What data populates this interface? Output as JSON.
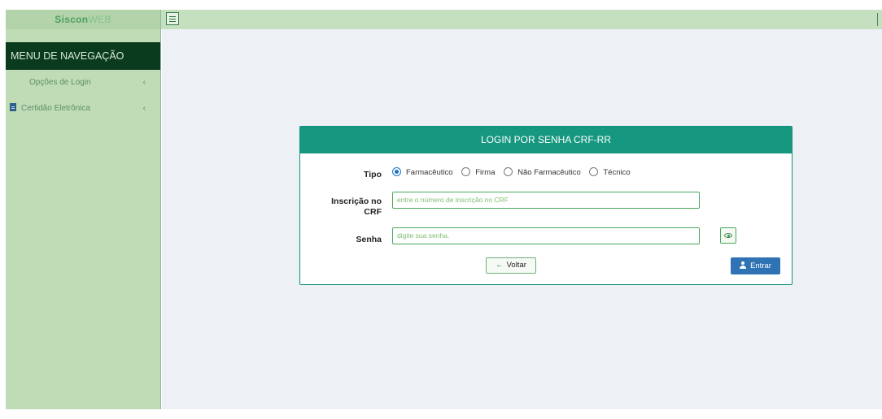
{
  "sidebar": {
    "brand_part1": "Siscon",
    "brand_part2": "WEB",
    "menu_header": "MENU DE NAVEGAÇÃO",
    "items": [
      {
        "label": "Opções de Login",
        "icon": "chevron-left-icon"
      },
      {
        "label": "Certidão Eletrônica",
        "icon": "document-icon"
      }
    ]
  },
  "login": {
    "title": "LOGIN POR SENHA CRF-RR",
    "tipo_label": "Tipo",
    "tipo_options": [
      {
        "label": "Farmacêutico",
        "selected": true
      },
      {
        "label": "Firma",
        "selected": false
      },
      {
        "label": "Não Farmacêutico",
        "selected": false
      },
      {
        "label": "Técnico",
        "selected": false
      }
    ],
    "inscricao_label_line1": "Inscrição no",
    "inscricao_label_line2": "CRF",
    "inscricao_placeholder": "entre o número de inscrição no CRF",
    "senha_label": "Senha",
    "senha_placeholder": "digite sua senha.",
    "voltar_label": "Voltar",
    "entrar_label": "Entrar"
  },
  "colors": {
    "panel_header": "#16977f",
    "menu_header": "#0b3b1f",
    "sidebar_bg": "#bfdcb7",
    "entrar_button": "#2f73b5"
  }
}
